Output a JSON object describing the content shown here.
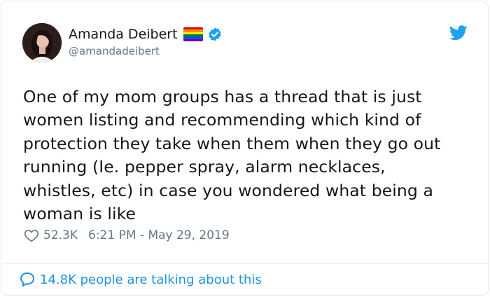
{
  "author": {
    "display_name": "Amanda Deibert",
    "handle": "@amandadeibert",
    "avatar_icon": "profile-photo",
    "badge_icons": [
      "rainbow-flag-icon",
      "verified-badge-icon"
    ]
  },
  "brand": {
    "logo_icon": "twitter-bird-icon",
    "accent_color": "#1DA1F2",
    "link_color": "#1B95E0"
  },
  "tweet": {
    "lines": [
      "One of my mom groups has a thread that is just",
      "women listing and recommending which kind of",
      "protection they take when them when they go out",
      "running (Ie. pepper spray, alarm necklaces,",
      "whistles, etc) in case you wondered what being a",
      "woman is like"
    ]
  },
  "meta": {
    "likes": "52.3K",
    "timestamp": "6:21 PM - May 29, 2019"
  },
  "footer": {
    "talking_text": "14.8K people are talking about this"
  }
}
